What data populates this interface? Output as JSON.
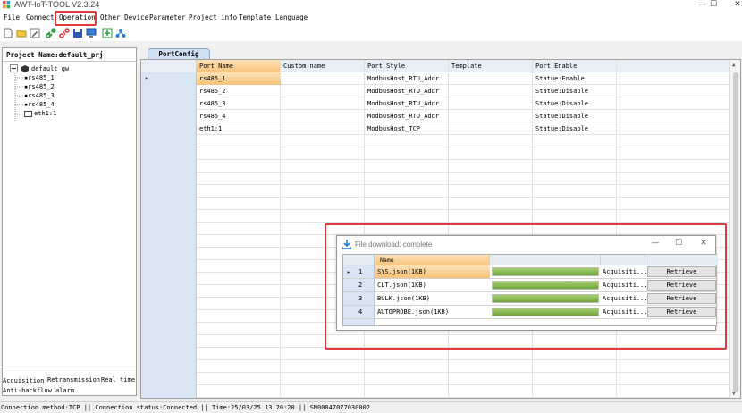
{
  "window": {
    "title": "AWT-IoT-TOOL V2.3.24",
    "controls": {
      "minimize": "—",
      "maximize": "☐",
      "close": "✕"
    }
  },
  "menu": [
    "File",
    "Connect",
    "Operation",
    "Other Device",
    "Parameter",
    "Project info",
    "Template",
    "Language"
  ],
  "toolbar_icons": [
    "new-file-icon",
    "open-folder-icon",
    "edit-icon",
    "connect-link-icon",
    "disconnect-link-icon",
    "save-icon",
    "monitor-icon",
    "export-icon",
    "network-icon"
  ],
  "project": {
    "title": "Project Name:default_prj",
    "tree": {
      "root": "default_gw",
      "children": [
        "rs485_1",
        "rs485_2",
        "rs485_3",
        "rs485_4",
        "eth1:1"
      ]
    }
  },
  "bottom_tabs": [
    "Acquisition",
    "Retransmission",
    "Real time",
    "Anti-backflow alarm"
  ],
  "tab": {
    "label": "PortConfig"
  },
  "grid": {
    "headers": [
      "Port Name",
      "Custom name",
      "Port Style",
      "Template",
      "Port Enable"
    ],
    "rows": [
      [
        "rs485_1",
        "",
        "ModbusHost_RTU_Addr",
        "",
        "Statue:Enable"
      ],
      [
        "rs485_2",
        "",
        "ModbusHost_RTU_Addr",
        "",
        "Statue:Disable"
      ],
      [
        "rs485_3",
        "",
        "ModbusHost_RTU_Addr",
        "",
        "Statue:Disable"
      ],
      [
        "rs485_4",
        "",
        "ModbusHost_RTU_Addr",
        "",
        "Statue:Disable"
      ],
      [
        "eth1:1",
        "",
        "ModbusHost_TCP",
        "",
        "Statue:Disable"
      ]
    ],
    "selected_row": 0
  },
  "download_window": {
    "title": "File download: complete",
    "header": "Name",
    "rows": [
      {
        "index": "1",
        "name": "SYS.json(1KB)",
        "progress": 1.0,
        "status": "Acquisiti...",
        "button": "Retrieve"
      },
      {
        "index": "2",
        "name": "CLT.json(1KB)",
        "progress": 1.0,
        "status": "Acquisiti...",
        "button": "Retrieve"
      },
      {
        "index": "3",
        "name": "BULK.json(1KB)",
        "progress": 1.0,
        "status": "Acquisiti...",
        "button": "Retrieve"
      },
      {
        "index": "4",
        "name": "AUTOPROBE.json(1KB)",
        "progress": 1.0,
        "status": "Acquisiti...",
        "button": "Retrieve"
      }
    ]
  },
  "status_bar": "Connection method:TCP || Connection status:Connected || Time:25/03/25 13:20:20 || SN00047077030002",
  "colors": {
    "highlight_red": "#e03a3a",
    "selected_row": "#f8c077",
    "grid_header": "#e8eef6",
    "row_header": "#d9e5f3",
    "progress_green": "#6fa43b"
  }
}
